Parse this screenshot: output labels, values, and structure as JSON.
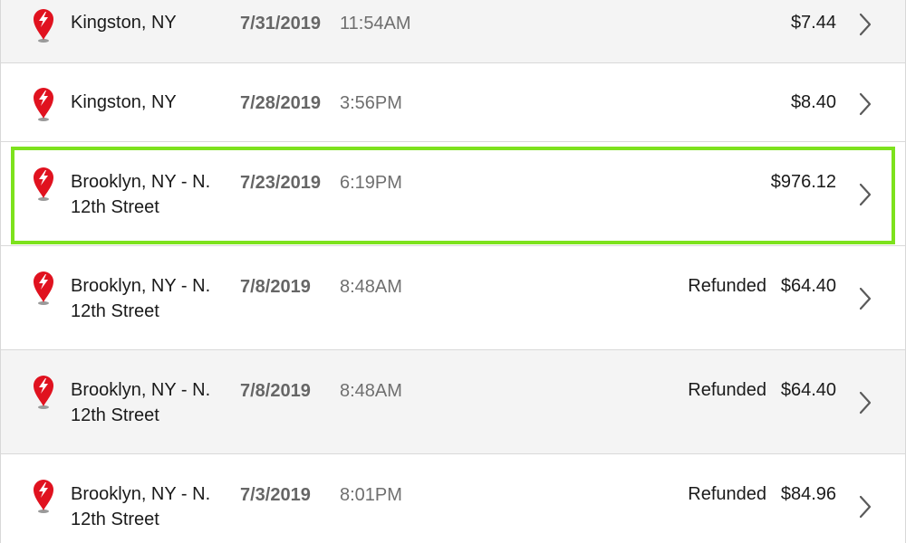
{
  "transactions": [
    {
      "location_line1": "Kingston, NY",
      "location_line2": "",
      "date": "7/31/2019",
      "time": "11:54AM",
      "status": "",
      "amount": "$7.44",
      "icon": "charging-pin-icon",
      "chevron": "chevron-right-icon"
    },
    {
      "location_line1": "Kingston, NY",
      "location_line2": "",
      "date": "7/28/2019",
      "time": "3:56PM",
      "status": "",
      "amount": "$8.40",
      "icon": "charging-pin-icon",
      "chevron": "chevron-right-icon"
    },
    {
      "location_line1": "Brooklyn, NY - N.",
      "location_line2": "12th Street",
      "date": "7/23/2019",
      "time": "6:19PM",
      "status": "",
      "amount": "$976.12",
      "icon": "charging-pin-icon",
      "chevron": "chevron-right-icon",
      "highlighted": true
    },
    {
      "location_line1": "Brooklyn, NY - N.",
      "location_line2": "12th Street",
      "date": "7/8/2019",
      "time": "8:48AM",
      "status": "Refunded",
      "amount": "$64.40",
      "icon": "charging-pin-icon",
      "chevron": "chevron-right-icon"
    },
    {
      "location_line1": "Brooklyn, NY - N.",
      "location_line2": "12th Street",
      "date": "7/8/2019",
      "time": "8:48AM",
      "status": "Refunded",
      "amount": "$64.40",
      "icon": "charging-pin-icon",
      "chevron": "chevron-right-icon"
    },
    {
      "location_line1": "Brooklyn, NY - N.",
      "location_line2": "12th Street",
      "date": "7/3/2019",
      "time": "8:01PM",
      "status": "Refunded",
      "amount": "$84.96",
      "icon": "charging-pin-icon",
      "chevron": "chevron-right-icon"
    }
  ],
  "colors": {
    "pin_red": "#e0121f",
    "highlight_green": "#7de21d",
    "shaded_row": "#f4f4f4"
  }
}
